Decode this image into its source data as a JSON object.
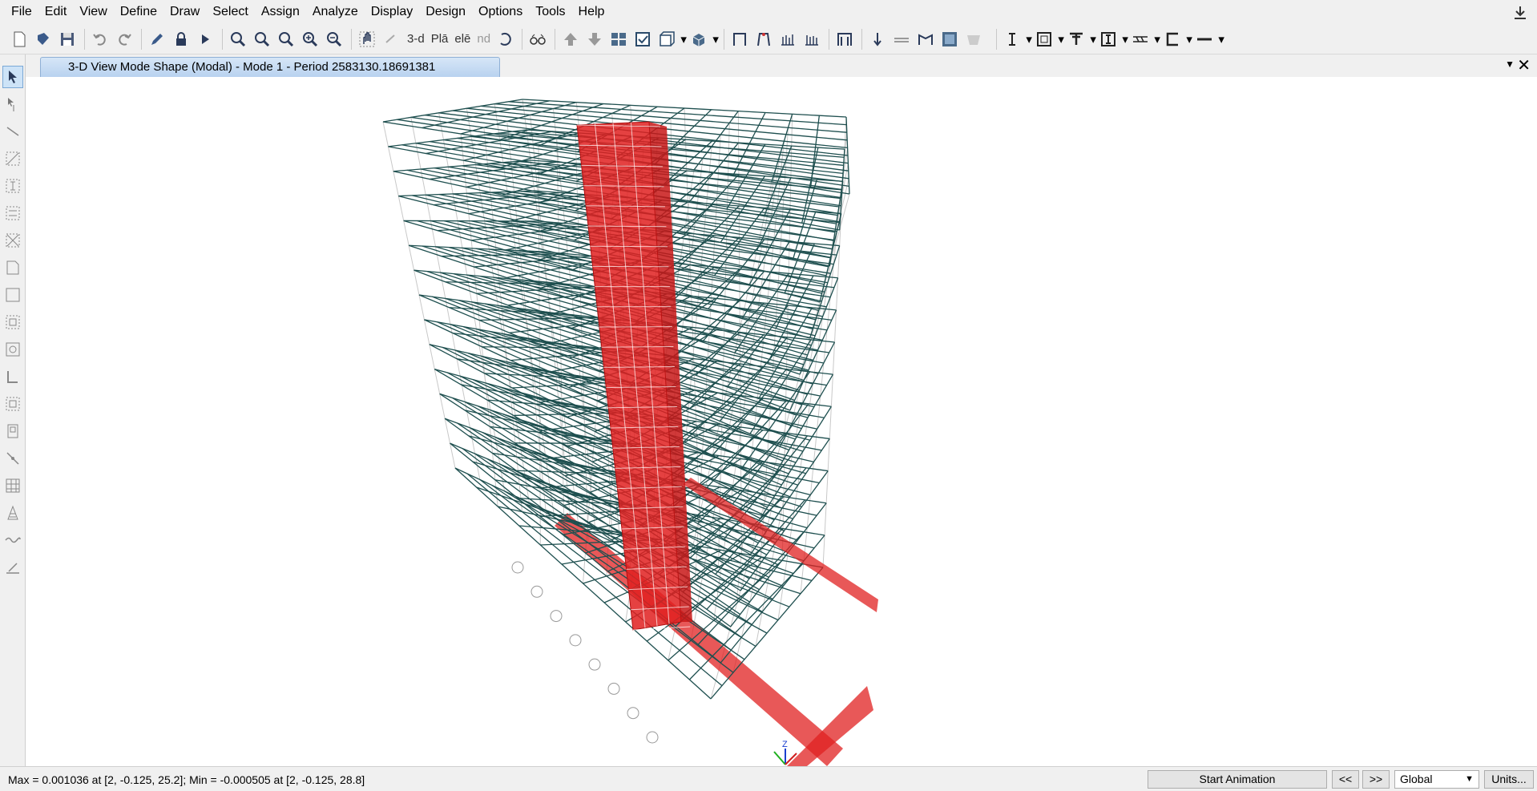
{
  "menu": {
    "items": [
      "File",
      "Edit",
      "View",
      "Define",
      "Draw",
      "Select",
      "Assign",
      "Analyze",
      "Display",
      "Design",
      "Options",
      "Tools",
      "Help"
    ]
  },
  "toolbar": {
    "view_3d_label": "3-d",
    "plan_label": "Plā",
    "elev_label": "elē",
    "nd_label": "nd"
  },
  "tab": {
    "title": "3-D View  Mode Shape (Modal) - Mode 1 - Period 2583130.18691381"
  },
  "axis": {
    "z_label": "Z"
  },
  "status": {
    "text": "Max = 0.001036 at [2, -0.125, 25.2];  Min = -0.000505 at [2, -0.125, 28.8]",
    "start_animation": "Start Animation",
    "step_back": "<<",
    "step_forward": ">>",
    "coordinate_system": "Global",
    "units": "Units..."
  },
  "colors": {
    "frame": "#1e4f4f",
    "wall": "#e02020",
    "grid": "#c8c8c8",
    "tab": "#b7d1ef"
  }
}
